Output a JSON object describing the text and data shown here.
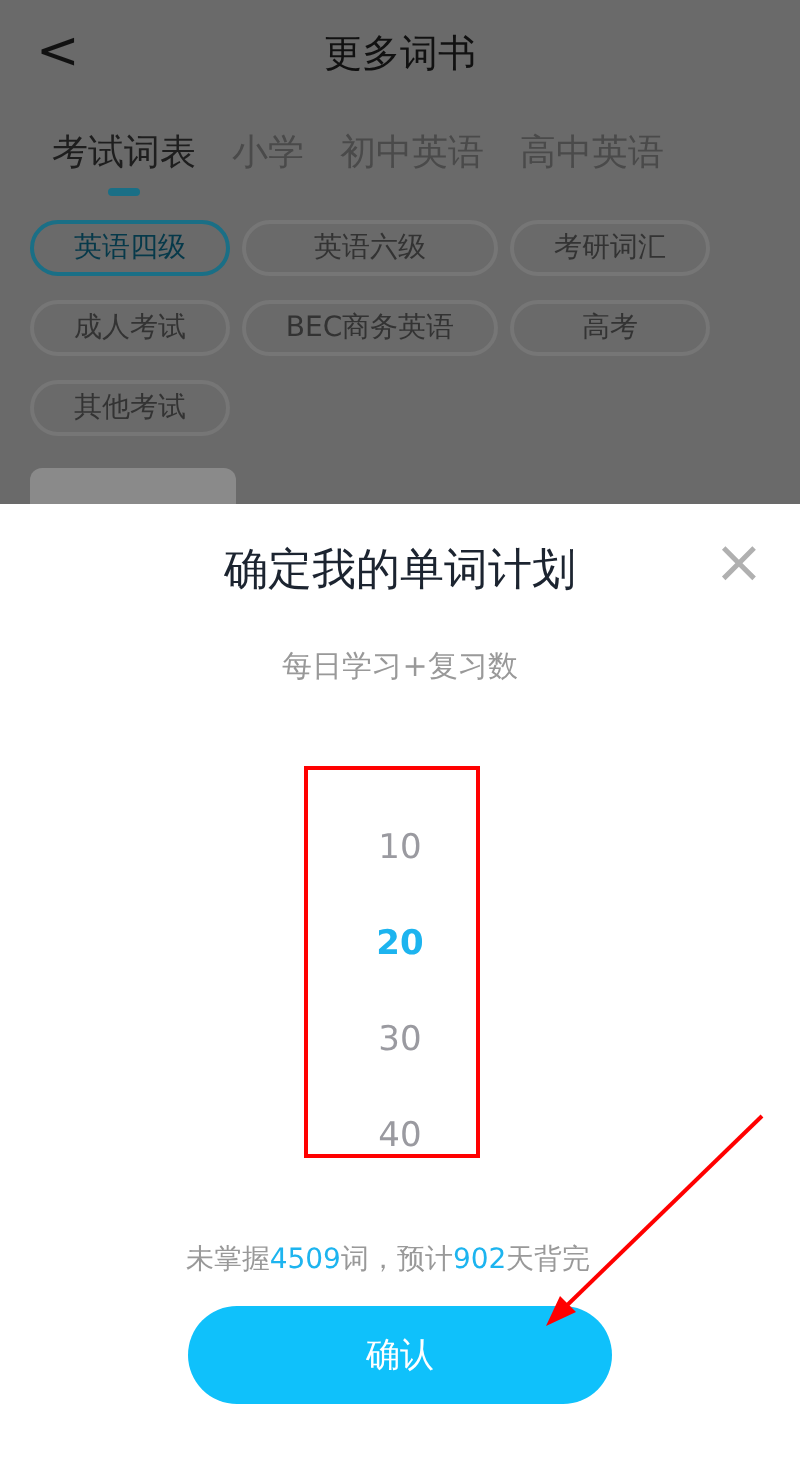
{
  "header": {
    "back": "<",
    "title": "更多词书"
  },
  "tabs": [
    {
      "label": "考试词表",
      "selected": true
    },
    {
      "label": "小学",
      "selected": false
    },
    {
      "label": "初中英语",
      "selected": false
    },
    {
      "label": "高中英语",
      "selected": false
    }
  ],
  "chips": [
    {
      "label": "英语四级",
      "selected": true
    },
    {
      "label": "英语六级",
      "selected": false
    },
    {
      "label": "考研词汇",
      "selected": false
    },
    {
      "label": "成人考试",
      "selected": false
    },
    {
      "label": "BEC商务英语",
      "selected": false
    },
    {
      "label": "高考",
      "selected": false
    },
    {
      "label": "其他考试",
      "selected": false
    }
  ],
  "sheet": {
    "title": "确定我的单词计划",
    "close": "×",
    "subtitle": "每日学习+复习数",
    "picker": [
      {
        "value": "10",
        "selected": false
      },
      {
        "value": "20",
        "selected": true
      },
      {
        "value": "30",
        "selected": false
      },
      {
        "value": "40",
        "selected": false
      }
    ],
    "summary": [
      {
        "text": "未掌握",
        "highlight": false
      },
      {
        "text": "4509",
        "highlight": true
      },
      {
        "text": "词，预计",
        "highlight": false
      },
      {
        "text": "902",
        "highlight": true
      },
      {
        "text": "天背完",
        "highlight": false
      }
    ],
    "confirm": "确认"
  }
}
